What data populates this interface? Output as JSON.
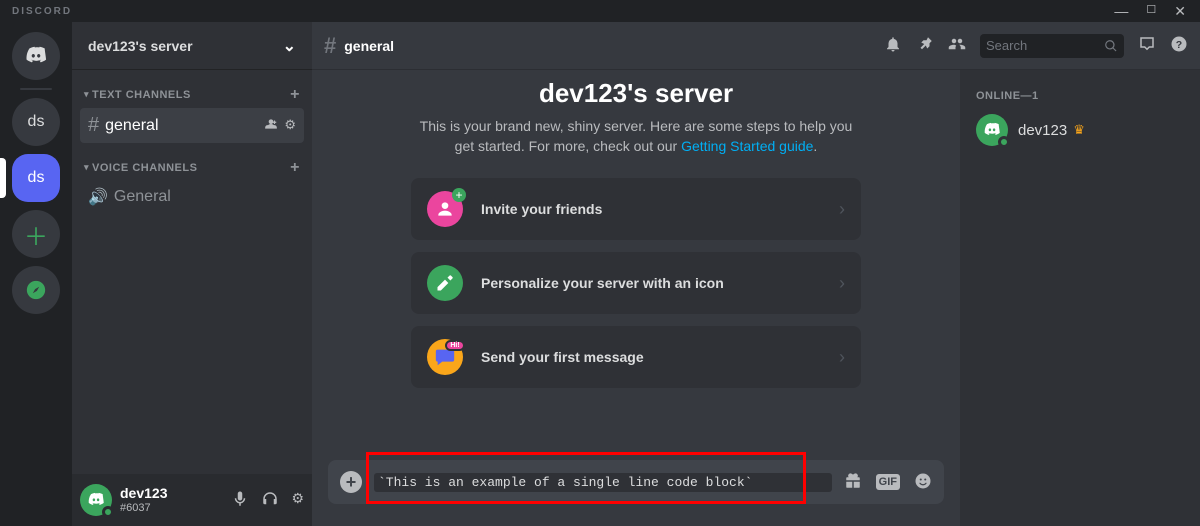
{
  "app": {
    "brand": "DISCORD"
  },
  "server": {
    "name": "dev123's server"
  },
  "channels": {
    "text_category": "TEXT CHANNELS",
    "voice_category": "VOICE CHANNELS",
    "text": {
      "general": "general"
    },
    "voice": {
      "general": "General"
    }
  },
  "topbar": {
    "channel_name": "general",
    "search_placeholder": "Search"
  },
  "welcome": {
    "title": "dev123's server",
    "subtitle_pre": "This is your brand new, shiny server. Here are some steps to help you get started. For more, check out our ",
    "subtitle_link": "Getting Started guide",
    "subtitle_post": ".",
    "cards": {
      "invite": "Invite your friends",
      "personalize": "Personalize your server with an icon",
      "first_msg": "Send your first message"
    }
  },
  "composer": {
    "value": "`This is an example of a single line code block`"
  },
  "members": {
    "header": "ONLINE—1",
    "user1": "dev123"
  },
  "user": {
    "name": "dev123",
    "discriminator": "#6037"
  },
  "guilds": {
    "g1": "ds",
    "g2": "ds"
  }
}
